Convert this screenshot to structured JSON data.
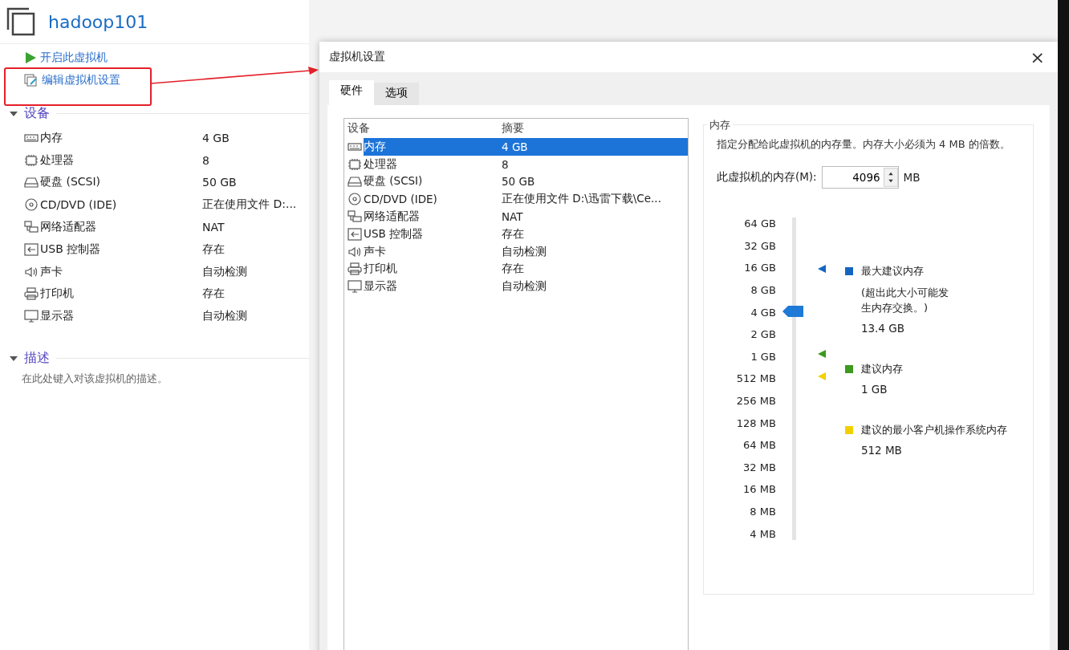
{
  "vm": {
    "title": "hadoop101",
    "actions": [
      {
        "kind": "power-on",
        "label": "开启此虚拟机"
      },
      {
        "kind": "edit",
        "label": "编辑虚拟机设置"
      }
    ],
    "devices_section": {
      "title": "设备",
      "expanded": true,
      "items": [
        {
          "kind": "memory",
          "name": "内存",
          "summary": "4 GB"
        },
        {
          "kind": "cpu",
          "name": "处理器",
          "summary": "8"
        },
        {
          "kind": "disk",
          "name": "硬盘 (SCSI)",
          "summary": "50 GB"
        },
        {
          "kind": "cd",
          "name": "CD/DVD (IDE)",
          "summary": "正在使用文件 D:..."
        },
        {
          "kind": "network",
          "name": "网络适配器",
          "summary": "NAT"
        },
        {
          "kind": "usb",
          "name": "USB 控制器",
          "summary": "存在"
        },
        {
          "kind": "sound",
          "name": "声卡",
          "summary": "自动检测"
        },
        {
          "kind": "printer",
          "name": "打印机",
          "summary": "存在"
        },
        {
          "kind": "display",
          "name": "显示器",
          "summary": "自动检测"
        }
      ]
    },
    "description_section": {
      "title": "描述",
      "expanded": true,
      "text": "在此处键入对该虚拟机的描述。"
    }
  },
  "dialog": {
    "title": "虚拟机设置",
    "close": "×",
    "tabs": [
      {
        "label": "硬件",
        "selected": true
      },
      {
        "label": "选项",
        "selected": false
      }
    ],
    "device_table": {
      "columns": [
        "设备",
        "摘要"
      ],
      "rows": [
        {
          "kind": "memory",
          "device": "内存",
          "summary": "4 GB",
          "selected": true
        },
        {
          "kind": "cpu",
          "device": "处理器",
          "summary": "8",
          "selected": false
        },
        {
          "kind": "disk",
          "device": "硬盘 (SCSI)",
          "summary": "50 GB",
          "selected": false
        },
        {
          "kind": "cd",
          "device": "CD/DVD (IDE)",
          "summary": "正在使用文件 D:\\迅雷下载\\Ce...",
          "selected": false
        },
        {
          "kind": "network",
          "device": "网络适配器",
          "summary": "NAT",
          "selected": false
        },
        {
          "kind": "usb",
          "device": "USB 控制器",
          "summary": "存在",
          "selected": false
        },
        {
          "kind": "sound",
          "device": "声卡",
          "summary": "自动检测",
          "selected": false
        },
        {
          "kind": "printer",
          "device": "打印机",
          "summary": "存在",
          "selected": false
        },
        {
          "kind": "display",
          "device": "显示器",
          "summary": "自动检测",
          "selected": false
        }
      ]
    },
    "memory": {
      "title": "内存",
      "description": "指定分配给此虚拟机的内存量。内存大小必须为 4 MB 的倍数。",
      "field_label": "此虚拟机的内存(M):",
      "value": "4096",
      "unit": "MB",
      "scale": [
        "64 GB",
        "32 GB",
        "16 GB",
        "8 GB",
        "4 GB",
        "2 GB",
        "1 GB",
        "512 MB",
        "256 MB",
        "128 MB",
        "64 MB",
        "32 MB",
        "16 MB",
        "8 MB",
        "4 MB"
      ],
      "slider": {
        "level": 0.714
      },
      "legend": [
        {
          "label": "最大建议内存",
          "note": "(超出此大小可能发生内存交换。)",
          "value": "13.4 GB",
          "color": "#1565c0"
        },
        {
          "label": "建议内存",
          "value": "1 GB",
          "color": "#3c9a1e"
        },
        {
          "label": "建议的最小客户机操作系统内存",
          "value": "512 MB",
          "color": "#f2d000"
        }
      ]
    }
  }
}
